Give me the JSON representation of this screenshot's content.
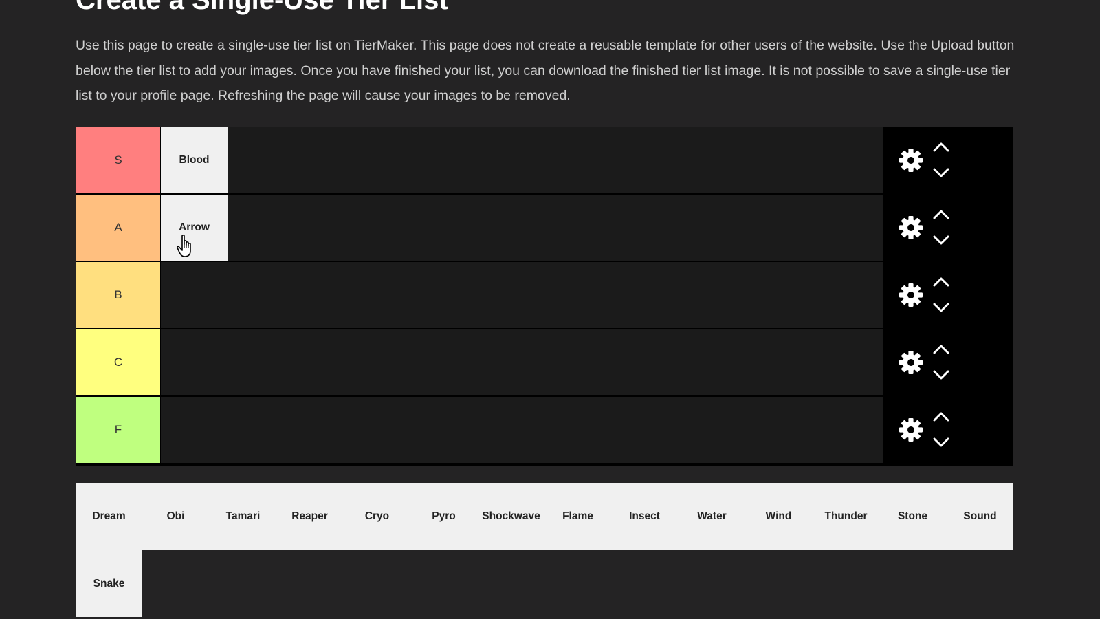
{
  "page": {
    "title": "Create a Single-Use Tier List",
    "intro": "Use this page to create a single-use tier list on TierMaker. This page does not create a reusable template for other users of the website. Use the Upload button below the tier list to add your images. Once you have finished your list, you can download the finished tier list image. It is not possible to save a single-use tier list to your profile page. Refreshing the page will cause your images to be removed."
  },
  "tiers": [
    {
      "label": "S",
      "color": "#ff7f7f",
      "items": [
        "Blood"
      ]
    },
    {
      "label": "A",
      "color": "#ffbf7f",
      "items": [
        "Arrow"
      ]
    },
    {
      "label": "B",
      "color": "#ffdf7f",
      "items": []
    },
    {
      "label": "C",
      "color": "#ffff7f",
      "items": []
    },
    {
      "label": "F",
      "color": "#bfff7f",
      "items": []
    }
  ],
  "icons": {
    "settings": "gear-icon",
    "move_up": "chevron-up-icon",
    "move_down": "chevron-down-icon",
    "cursor": "hand-pointer-icon"
  },
  "pool": {
    "items": [
      "Dream",
      "Obi",
      "Tamari",
      "Reaper",
      "Cryo",
      "Pyro",
      "Shockwave",
      "Flame",
      "Insect",
      "Water",
      "Wind",
      "Thunder",
      "Stone",
      "Sound",
      "Snake"
    ]
  }
}
